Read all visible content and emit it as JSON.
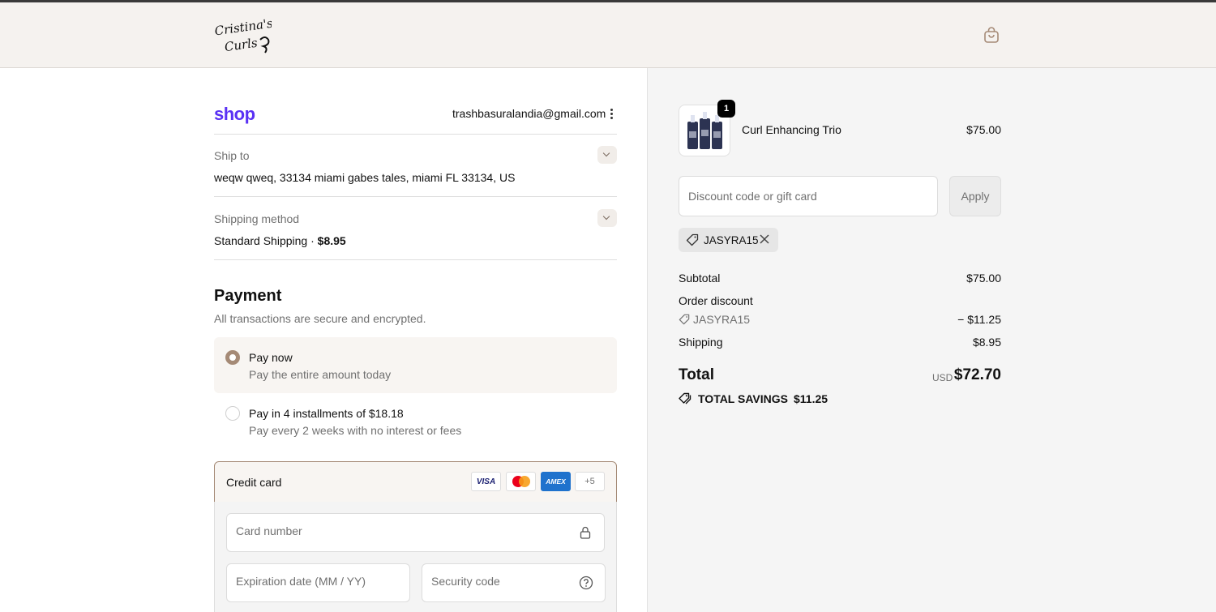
{
  "brand": {
    "logo_text": "Cristina's Curls"
  },
  "header": {
    "cart_icon": "shopping-bag-icon"
  },
  "account": {
    "shop_logo": "shop",
    "email": "trashbasuralandia@gmail.com"
  },
  "ship_to": {
    "label": "Ship to",
    "value": "weqw qweq, 33134 miami gabes tales, miami FL 33134, US"
  },
  "shipping_method": {
    "label": "Shipping method",
    "name": "Standard Shipping",
    "separator": " · ",
    "price": "$8.95"
  },
  "payment": {
    "title": "Payment",
    "subtitle": "All transactions are secure and encrypted.",
    "options": [
      {
        "title": "Pay now",
        "subtitle": "Pay the entire amount today",
        "selected": true
      },
      {
        "title": "Pay in 4 installments of $18.18",
        "subtitle": "Pay every 2 weeks with no interest or fees",
        "selected": false
      }
    ],
    "credit_card": {
      "label": "Credit card",
      "brands": [
        "VISA",
        "Mastercard",
        "AMEX"
      ],
      "more": "+5",
      "card_number_placeholder": "Card number",
      "expiration_placeholder": "Expiration date (MM / YY)",
      "security_placeholder": "Security code"
    }
  },
  "cart": {
    "items": [
      {
        "name": "Curl Enhancing Trio",
        "price": "$75.00",
        "quantity": "1"
      }
    ],
    "discount_placeholder": "Discount code or gift card",
    "apply_label": "Apply",
    "applied_code": "JASYRA15"
  },
  "summary": {
    "subtotal_label": "Subtotal",
    "subtotal_value": "$75.00",
    "order_discount_label": "Order discount",
    "discount_code": "JASYRA15",
    "discount_value": "− $11.25",
    "shipping_label": "Shipping",
    "shipping_value": "$8.95",
    "total_label": "Total",
    "currency": "USD",
    "total_value": "$72.70",
    "savings_label": "TOTAL SAVINGS",
    "savings_value": "$11.25"
  },
  "colors": {
    "accent": "#a58a76",
    "shop_purple": "#5a31f4",
    "header_bg": "#f5f2ef"
  }
}
